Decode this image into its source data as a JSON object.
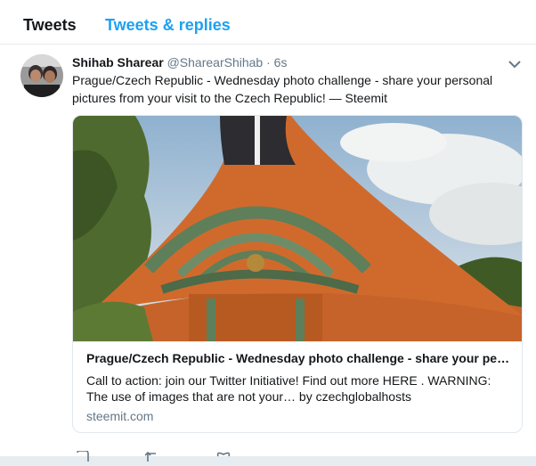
{
  "tabs": [
    {
      "label": "Tweets"
    },
    {
      "label": "Tweets & replies"
    }
  ],
  "tweet": {
    "author_name": "Shihab Sharear",
    "author_handle": "@SharearShihab",
    "separator": "·",
    "timestamp": "6s",
    "text": "Prague/Czech Republic - Wednesday photo challenge - share your personal pictures from your visit to the Czech Republic! — Steemit",
    "card": {
      "title": "Prague/Czech Republic - Wednesday photo challenge - share your pe…",
      "description": "Call to action: join our Twitter Initiative! Find out more HERE . WARNING: The use of images that are not your… by czechglobalhosts",
      "domain": "steemit.com"
    }
  },
  "icons": {
    "more": "chevron-down-icon",
    "reply": "reply-icon",
    "retweet": "retweet-icon",
    "like": "heart-icon"
  },
  "colors": {
    "accent": "#1da1f2",
    "text": "#14171a",
    "secondary_text": "#657786",
    "border": "#e1e8ed"
  }
}
